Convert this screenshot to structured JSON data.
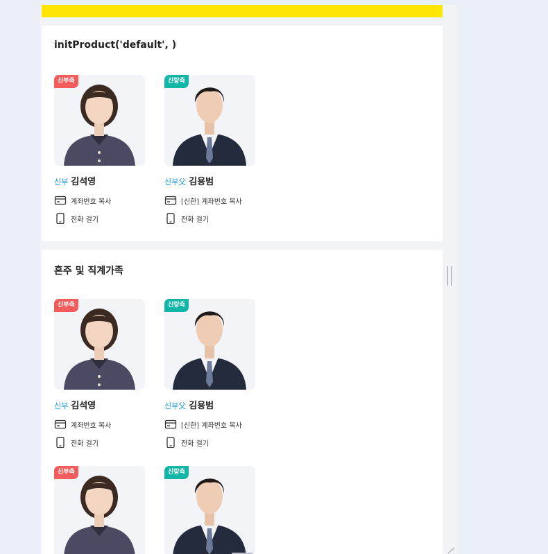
{
  "sections": [
    {
      "title": "initProduct('default', )",
      "cards": [
        {
          "badge": "신부측",
          "side": "bride",
          "role": "신부",
          "name": "김석영",
          "account": "계좌번호 복사",
          "call": "전화 걸기"
        },
        {
          "badge": "신랑측",
          "side": "groom",
          "role": "신부父",
          "name": "김용범",
          "account": "[신한] 계좌번호 복사",
          "call": "전화 걸기"
        }
      ]
    },
    {
      "title": "혼주 및 직계가족",
      "cards": [
        {
          "badge": "신부측",
          "side": "bride",
          "role": "신부",
          "name": "김석영",
          "account": "계좌번호 복사",
          "call": "전화 걸기"
        },
        {
          "badge": "신랑측",
          "side": "groom",
          "role": "신부父",
          "name": "김용범",
          "account": "[신한] 계좌번호 복사",
          "call": "전화 걸기"
        },
        {
          "badge": "신부측",
          "side": "bride"
        },
        {
          "badge": "신랑측",
          "side": "groom"
        }
      ]
    }
  ],
  "colors": {
    "top_bar": "#ffe600",
    "bride_badge": "#f45b5b",
    "groom_badge": "#12b6a6",
    "role_text": "#1a97df"
  },
  "icons": {
    "account": "card-icon",
    "call": "phone-icon"
  }
}
